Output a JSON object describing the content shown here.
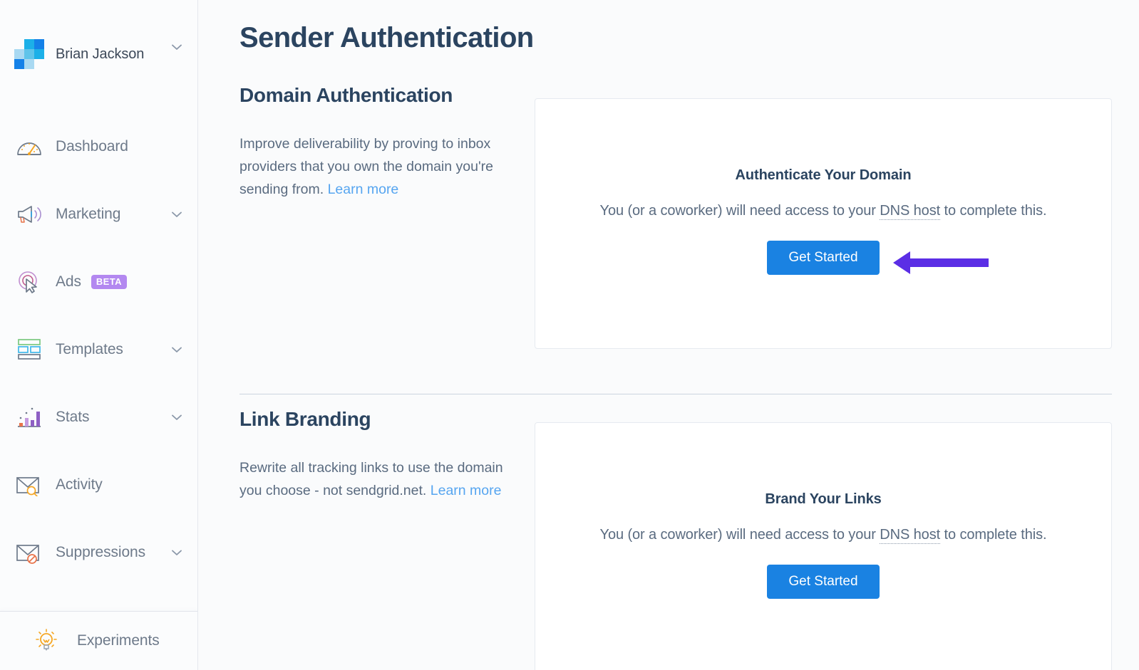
{
  "sidebar": {
    "account": {
      "name": "Brian Jackson",
      "logo_icon": "sendgrid-mosaic-logo",
      "chevron_icon": "chevron-down-icon"
    },
    "items": [
      {
        "label": "Dashboard",
        "icon": "speedometer-icon",
        "expandable": false,
        "badge": null
      },
      {
        "label": "Marketing",
        "icon": "megaphone-icon",
        "expandable": true,
        "badge": null
      },
      {
        "label": "Ads",
        "icon": "cursor-target-icon",
        "expandable": false,
        "badge": "BETA"
      },
      {
        "label": "Templates",
        "icon": "template-grid-icon",
        "expandable": true,
        "badge": null
      },
      {
        "label": "Stats",
        "icon": "bar-chart-icon",
        "expandable": true,
        "badge": null
      },
      {
        "label": "Activity",
        "icon": "envelope-search-icon",
        "expandable": false,
        "badge": null
      },
      {
        "label": "Suppressions",
        "icon": "envelope-block-icon",
        "expandable": true,
        "badge": null
      }
    ],
    "footer": {
      "label": "Experiments",
      "icon": "lightbulb-icon"
    }
  },
  "main": {
    "page_title": "Sender Authentication",
    "sections": [
      {
        "title": "Domain Authentication",
        "description": "Improve deliverability by proving to inbox providers that you own the domain you're sending from. ",
        "learn_more": "Learn more",
        "card": {
          "title": "Authenticate Your Domain",
          "subtitle_before": "You (or a coworker) will need access to your ",
          "subtitle_tooltip": "DNS host",
          "subtitle_after": " to complete this.",
          "button": "Get Started"
        }
      },
      {
        "title": "Link Branding",
        "description": "Rewrite all tracking links to use the domain you choose - not sendgrid.net. ",
        "learn_more": "Learn more",
        "card": {
          "title": "Brand Your Links",
          "subtitle_before": "You (or a coworker) will need access to your ",
          "subtitle_tooltip": "DNS host",
          "subtitle_after": " to complete this.",
          "button": "Get Started"
        }
      }
    ]
  },
  "annotation": {
    "type": "left-arrow",
    "color": "#5b2ee5"
  },
  "colors": {
    "accent_blue": "#1a82e2",
    "link_blue": "#56a5f0",
    "heading_navy": "#2b4460",
    "body_grey": "#5a6b80",
    "nav_grey": "#6e7a8a",
    "badge_purple": "#b388f0",
    "arrow_purple": "#5b2ee5",
    "page_bg": "#fafbfc",
    "card_bg": "#ffffff",
    "border": "#e6eaf0"
  }
}
